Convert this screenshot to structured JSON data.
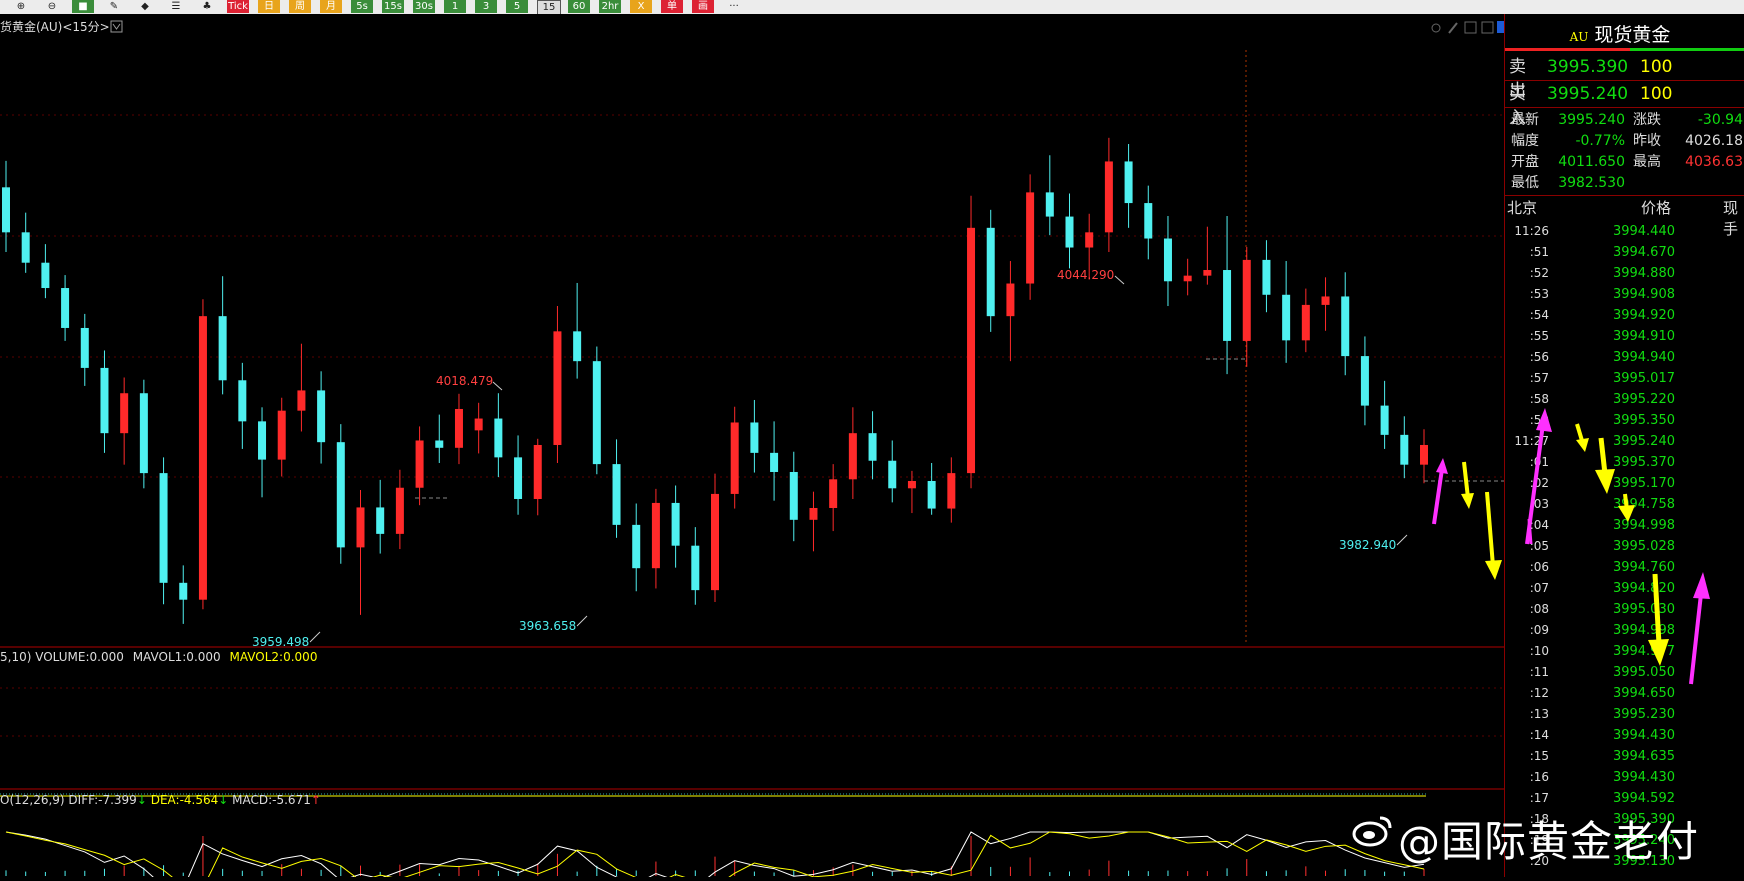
{
  "toolbar": {
    "buttons": [
      {
        "label": "⊕",
        "kind": "plain"
      },
      {
        "label": "⊖",
        "kind": "plain"
      },
      {
        "label": "■",
        "kind": "green"
      },
      {
        "label": "✎",
        "kind": "plain"
      },
      {
        "label": "◆",
        "kind": "plain"
      },
      {
        "label": "☰",
        "kind": "plain"
      },
      {
        "label": "♣",
        "kind": "plain"
      },
      {
        "label": "Tick",
        "kind": "red"
      },
      {
        "label": "日",
        "kind": "orange"
      },
      {
        "label": "周",
        "kind": "orange"
      },
      {
        "label": "月",
        "kind": "orange"
      },
      {
        "label": "5s",
        "kind": "green"
      },
      {
        "label": "15s",
        "kind": "green"
      },
      {
        "label": "30s",
        "kind": "green"
      },
      {
        "label": "1",
        "kind": "green"
      },
      {
        "label": "3",
        "kind": "green"
      },
      {
        "label": "5",
        "kind": "green"
      },
      {
        "label": "15",
        "kind": "box"
      },
      {
        "label": "60",
        "kind": "green"
      },
      {
        "label": "2hr",
        "kind": "green"
      },
      {
        "label": "X",
        "kind": "orange"
      },
      {
        "label": "单",
        "kind": "red"
      },
      {
        "label": "画",
        "kind": "red"
      },
      {
        "label": "···",
        "kind": "plain"
      }
    ]
  },
  "chart": {
    "title": "货黄金(AU)<15分>",
    "volume_label_prefix": "5,10) VOLUME:0.000",
    "mavol1": "MAVOL1:0.000",
    "mavol2": "MAVOL2:0.000",
    "macd_prefix": "O(12,26,9) DIFF:-7.399",
    "dea": "DEA:-4.564",
    "macd_value": "MACD:-5.671",
    "annotations": {
      "high1": "4018.479",
      "high2": "4044.290",
      "low1": "3959.498",
      "low2": "3963.658",
      "low3": "3982.940"
    },
    "colors": {
      "up": "#ff2a2a",
      "down": "#4ff0f0",
      "dea": "#ffff00",
      "diff": "#ffffff"
    }
  },
  "chart_data": {
    "type": "candlestick",
    "title": "货黄金(AU)<15分>",
    "candles": [
      [
        4035.5,
        4040.2,
        4024.0,
        4027.5
      ],
      [
        4027.5,
        4031.0,
        4020.3,
        4022.1
      ],
      [
        4022.1,
        4025.4,
        4015.8,
        4017.6
      ],
      [
        4017.6,
        4019.9,
        4008.2,
        4010.5
      ],
      [
        4010.5,
        4013.0,
        4000.2,
        4003.4
      ],
      [
        4003.4,
        4006.5,
        3988.3,
        3991.8
      ],
      [
        3991.8,
        4001.7,
        3986.2,
        3998.9
      ],
      [
        3998.9,
        4001.3,
        3982.0,
        3984.7
      ],
      [
        3984.7,
        3987.5,
        3961.4,
        3965.2
      ],
      [
        3965.2,
        3968.3,
        3957.9,
        3962.2
      ],
      [
        3962.2,
        4015.6,
        3960.5,
        4012.6
      ],
      [
        4012.6,
        4019.7,
        3998.7,
        4001.2
      ],
      [
        4001.2,
        4004.3,
        3989.0,
        3993.9
      ],
      [
        3993.9,
        3996.4,
        3980.4,
        3987.1
      ],
      [
        3987.1,
        3998.1,
        3984.1,
        3995.8
      ],
      [
        3995.8,
        4007.7,
        3992.1,
        3999.4
      ],
      [
        3999.4,
        4002.8,
        3986.4,
        3990.2
      ],
      [
        3990.2,
        3993.4,
        3968.6,
        3971.5
      ],
      [
        3971.5,
        3981.7,
        3959.5,
        3978.6
      ],
      [
        3978.6,
        3983.5,
        3970.4,
        3973.9
      ],
      [
        3973.9,
        3985.3,
        3971.2,
        3982.1
      ],
      [
        3982.1,
        3993.0,
        3979.0,
        3990.5
      ],
      [
        3990.5,
        3995.1,
        3986.5,
        3989.2
      ],
      [
        3989.2,
        3998.8,
        3986.3,
        3996.1
      ],
      [
        3992.3,
        3997.2,
        3988.2,
        3994.4
      ],
      [
        3994.4,
        3998.9,
        3984.0,
        3987.5
      ],
      [
        3987.5,
        3991.4,
        3977.3,
        3980.1
      ],
      [
        3980.1,
        3990.8,
        3977.2,
        3989.7
      ],
      [
        3989.7,
        4014.4,
        3986.5,
        4009.9
      ],
      [
        4009.9,
        4018.5,
        4001.5,
        4004.6
      ],
      [
        4004.6,
        4007.2,
        3984.5,
        3986.3
      ],
      [
        3986.3,
        3990.7,
        3973.2,
        3975.5
      ],
      [
        3975.5,
        3979.3,
        3963.7,
        3967.8
      ],
      [
        3967.8,
        3981.9,
        3964.2,
        3979.4
      ],
      [
        3979.4,
        3982.5,
        3967.9,
        3971.8
      ],
      [
        3971.8,
        3975.1,
        3961.3,
        3963.9
      ],
      [
        3963.9,
        3984.6,
        3961.8,
        3981.0
      ],
      [
        3981.0,
        3996.5,
        3978.4,
        3993.7
      ],
      [
        3993.7,
        3997.7,
        3984.8,
        3988.3
      ],
      [
        3988.3,
        3993.9,
        3979.8,
        3984.9
      ],
      [
        3984.9,
        3988.5,
        3972.6,
        3976.4
      ],
      [
        3976.4,
        3981.4,
        3970.8,
        3978.5
      ],
      [
        3978.5,
        3986.3,
        3974.4,
        3983.6
      ],
      [
        3983.6,
        3996.4,
        3980.1,
        3991.8
      ],
      [
        3991.8,
        3995.7,
        3983.6,
        3986.9
      ],
      [
        3986.9,
        3990.5,
        3979.5,
        3982.0
      ],
      [
        3982.0,
        3985.1,
        3977.6,
        3983.3
      ],
      [
        3983.3,
        3986.5,
        3977.3,
        3978.4
      ],
      [
        3978.4,
        3987.5,
        3975.9,
        3984.7
      ],
      [
        3984.7,
        4034.0,
        3982.0,
        4028.3
      ],
      [
        4028.3,
        4031.5,
        4009.8,
        4012.6
      ],
      [
        4012.6,
        4022.4,
        4004.6,
        4018.4
      ],
      [
        4018.4,
        4037.8,
        4015.5,
        4034.6
      ],
      [
        4034.6,
        4041.2,
        4027.0,
        4030.3
      ],
      [
        4030.3,
        4034.4,
        4021.1,
        4024.8
      ],
      [
        4024.8,
        4030.8,
        4019.1,
        4027.5
      ],
      [
        4027.5,
        4044.3,
        4024.0,
        4040.1
      ],
      [
        4040.1,
        4043.2,
        4028.3,
        4032.7
      ],
      [
        4032.7,
        4035.8,
        4022.7,
        4026.4
      ],
      [
        4026.4,
        4030.4,
        4014.4,
        4018.8
      ],
      [
        4018.8,
        4022.8,
        4016.3,
        4019.8
      ],
      [
        4019.8,
        4028.5,
        4018.2,
        4020.8
      ],
      [
        4020.8,
        4030.4,
        4002.3,
        4008.2
      ],
      [
        4008.2,
        4024.9,
        4003.6,
        4022.6
      ],
      [
        4022.6,
        4026.1,
        4013.3,
        4016.4
      ],
      [
        4016.4,
        4022.4,
        4004.3,
        4008.3
      ],
      [
        4008.3,
        4017.5,
        4006.2,
        4014.6
      ],
      [
        4014.6,
        4019.5,
        4010.0,
        4016.1
      ],
      [
        4016.1,
        4020.4,
        4002.1,
        4005.5
      ],
      [
        4005.5,
        4009.0,
        3993.2,
        3996.7
      ],
      [
        3996.7,
        4001.1,
        3989.0,
        3991.5
      ],
      [
        3991.5,
        3994.8,
        3983.8,
        3986.2
      ],
      [
        3986.2,
        3992.5,
        3982.9,
        3989.7
      ]
    ],
    "annotations": [
      {
        "label": "4018.479",
        "type": "high"
      },
      {
        "label": "4044.290",
        "type": "high"
      },
      {
        "label": "3959.498",
        "type": "low"
      },
      {
        "label": "3963.658",
        "type": "low"
      },
      {
        "label": "3982.940",
        "type": "low"
      }
    ],
    "indicators": {
      "volume": {
        "VOLUME": 0.0,
        "MAVOL1": 0.0,
        "MAVOL2": 0.0
      },
      "macd": {
        "DIFF": -7.399,
        "DEA": -4.564,
        "MACD": -5.671
      }
    }
  },
  "quote": {
    "code": "AU",
    "name": "现货黄金",
    "sell_label": "卖出",
    "sell_price": "3995.390",
    "sell_vol": "100",
    "buy_label": "买入",
    "buy_price": "3995.240",
    "buy_vol": "100",
    "stats": [
      {
        "label": "最新",
        "value": "3995.240",
        "color": "#1d1",
        "label2": "涨跌",
        "value2": "-30.94",
        "color2": "#1d1"
      },
      {
        "label": "幅度",
        "value": "-0.77%",
        "color": "#1d1",
        "label2": "昨收",
        "value2": "4026.18",
        "color2": "#ddd"
      },
      {
        "label": "开盘",
        "value": "4011.650",
        "color": "#1d1",
        "label2": "最高",
        "value2": "4036.63",
        "color2": "#f33"
      },
      {
        "label": "最低",
        "value": "3982.530",
        "color": "#1d1",
        "label2": "",
        "value2": "",
        "color2": "#ddd"
      }
    ]
  },
  "ticks": {
    "head_time": "北京",
    "head_price": "价格",
    "head_vol": "现手",
    "rows": [
      {
        "t": "11:26",
        "p": "3994.440"
      },
      {
        "t": ":51",
        "p": "3994.670"
      },
      {
        "t": ":52",
        "p": "3994.880"
      },
      {
        "t": ":53",
        "p": "3994.908"
      },
      {
        "t": ":54",
        "p": "3994.920"
      },
      {
        "t": ":55",
        "p": "3994.910"
      },
      {
        "t": ":56",
        "p": "3994.940"
      },
      {
        "t": ":57",
        "p": "3995.017"
      },
      {
        "t": ":58",
        "p": "3995.220"
      },
      {
        "t": ":59",
        "p": "3995.350"
      },
      {
        "t": "11:27",
        "p": "3995.240"
      },
      {
        "t": ":01",
        "p": "3995.370"
      },
      {
        "t": ":02",
        "p": "3995.170"
      },
      {
        "t": ":03",
        "p": "3994.758"
      },
      {
        "t": ":04",
        "p": "3994.998"
      },
      {
        "t": ":05",
        "p": "3995.028"
      },
      {
        "t": ":06",
        "p": "3994.760"
      },
      {
        "t": ":07",
        "p": "3994.820"
      },
      {
        "t": ":08",
        "p": "3995.030"
      },
      {
        "t": ":09",
        "p": "3994.998"
      },
      {
        "t": ":10",
        "p": "3994.977"
      },
      {
        "t": ":11",
        "p": "3995.050"
      },
      {
        "t": ":12",
        "p": "3994.650"
      },
      {
        "t": ":13",
        "p": "3995.230"
      },
      {
        "t": ":14",
        "p": "3994.430"
      },
      {
        "t": ":15",
        "p": "3994.635"
      },
      {
        "t": ":16",
        "p": "3994.430"
      },
      {
        "t": ":17",
        "p": "3994.592"
      },
      {
        "t": ":18",
        "p": "3995.390"
      },
      {
        "t": ":19",
        "p": "3995.240"
      },
      {
        "t": ":20",
        "p": "3995.130"
      }
    ]
  },
  "watermark": "@国际黄金老付"
}
